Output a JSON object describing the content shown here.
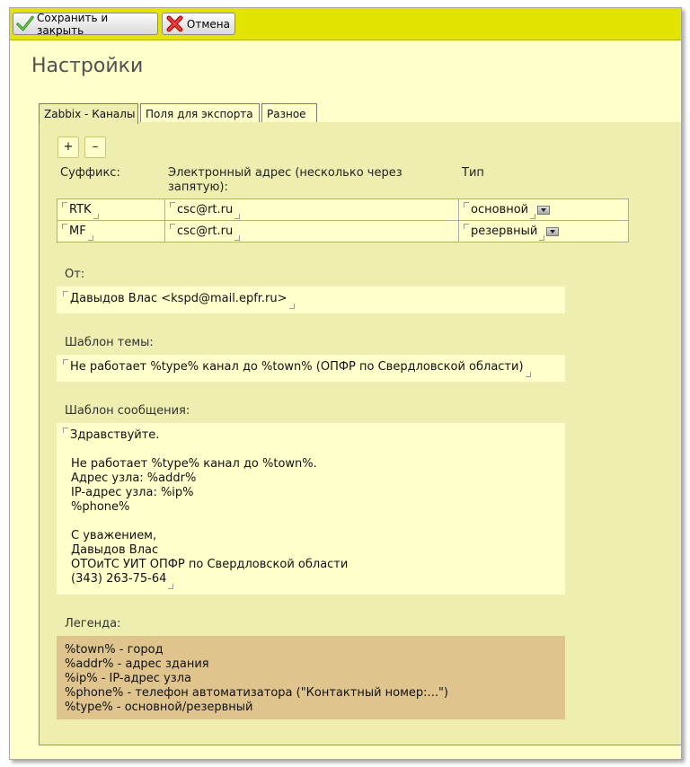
{
  "toolbar": {
    "save_label": "Сохранить и закрыть",
    "cancel_label": "Отмена"
  },
  "page": {
    "title": "Настройки"
  },
  "tabs": [
    {
      "label": "Zabbix - Каналы",
      "active": true
    },
    {
      "label": "Поля для экспорта",
      "active": false
    },
    {
      "label": "Разное",
      "active": false
    }
  ],
  "channels": {
    "add_label": "+",
    "remove_label": "–",
    "headers": {
      "suffix": "Суффикс:",
      "email_line1": "Электронный адрес (несколько через",
      "email_line2": "запятую):",
      "type": "Тип"
    },
    "rows": [
      {
        "suffix": "RTK",
        "email": "csc@rt.ru",
        "type": "основной"
      },
      {
        "suffix": "MF",
        "email": "csc@rt.ru",
        "type": "резервный"
      }
    ]
  },
  "from": {
    "label": "От:",
    "value": "Давыдов Влас <kspd@mail.epfr.ru>"
  },
  "subject": {
    "label": "Шаблон темы:",
    "value": "Не работает %type% канал до %town% (ОПФР по Свердловской области)"
  },
  "message": {
    "label": "Шаблон сообщения:",
    "lines": [
      "Здравствуйте.",
      "",
      "Не работает %type% канал до %town%.",
      "Адрес узла: %addr%",
      "IP-адрес узла: %ip%",
      "%phone%",
      "",
      "С уважением,",
      "Давыдов Влас",
      "ОТОиТС УИТ ОПФР по Свердловской области",
      "(343) 263-75-64"
    ]
  },
  "legend": {
    "label": "Легенда:",
    "lines": [
      "%town% - город",
      "%addr% - адрес здания",
      "%ip% - IP-адрес узла",
      "%phone% - телефон автоматизатора (\"Контактный номер:...\")",
      "%type% - основной/резервный"
    ]
  },
  "colors": {
    "toolbar_bg": "#e3e300",
    "page_bg": "#ffffcc",
    "panel_bg": "#eeeeb0",
    "legend_bg": "#dfc48e"
  },
  "icons": {
    "save": "checkmark-icon",
    "cancel": "red-x-icon"
  }
}
